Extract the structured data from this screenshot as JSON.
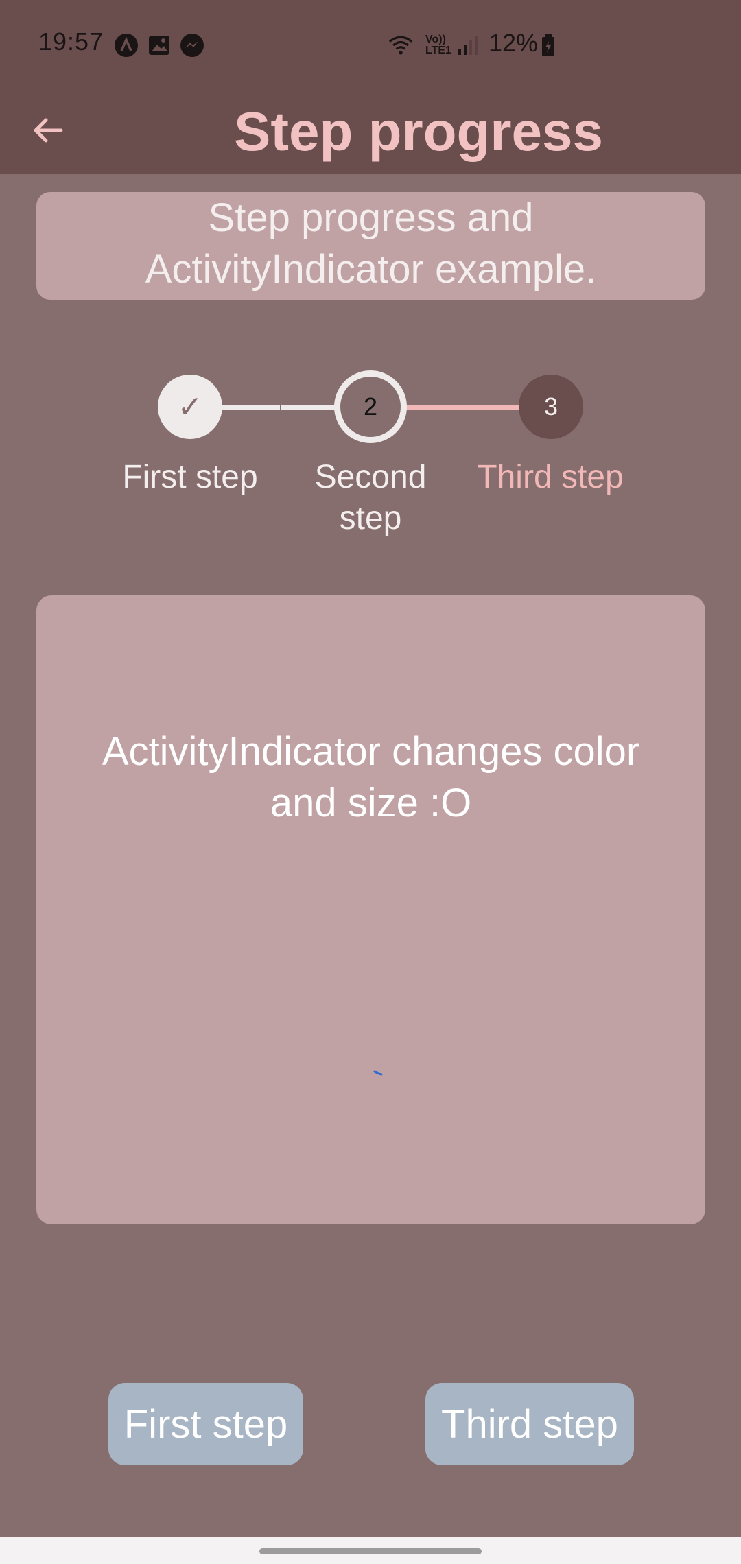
{
  "status_bar": {
    "time": "19:57",
    "network": "Vo)) LTE1",
    "battery": "12%",
    "icons": [
      "app-a-icon",
      "gallery-icon",
      "messenger-icon",
      "wifi-icon",
      "signal-icon",
      "battery-icon"
    ]
  },
  "app_bar": {
    "title": "Step progress",
    "back_icon": "arrow-left-icon"
  },
  "intro": {
    "line1": "Step progress and",
    "line2": "ActivityIndicator example."
  },
  "stepper": {
    "steps": [
      {
        "number": "1",
        "label_line1": "First step",
        "label_line2": "",
        "state": "completed",
        "check": "✓"
      },
      {
        "number": "2",
        "label_line1": "Second",
        "label_line2": "step",
        "state": "current"
      },
      {
        "number": "3",
        "label_line1": "Third step",
        "label_line2": "",
        "state": "upcoming"
      }
    ]
  },
  "activity": {
    "line1": "ActivityIndicator changes color",
    "line2": "and size :O"
  },
  "buttons": {
    "first": "First step",
    "third": "Third step"
  },
  "colors": {
    "background": "#876e6e",
    "app_bar": "#6a4d4d",
    "title": "#f2c2c2",
    "card": "#c0a2a4",
    "button": "#a8b5c4",
    "accent_pink": "#f2b8b8",
    "spinner": "#2e6ad1"
  }
}
